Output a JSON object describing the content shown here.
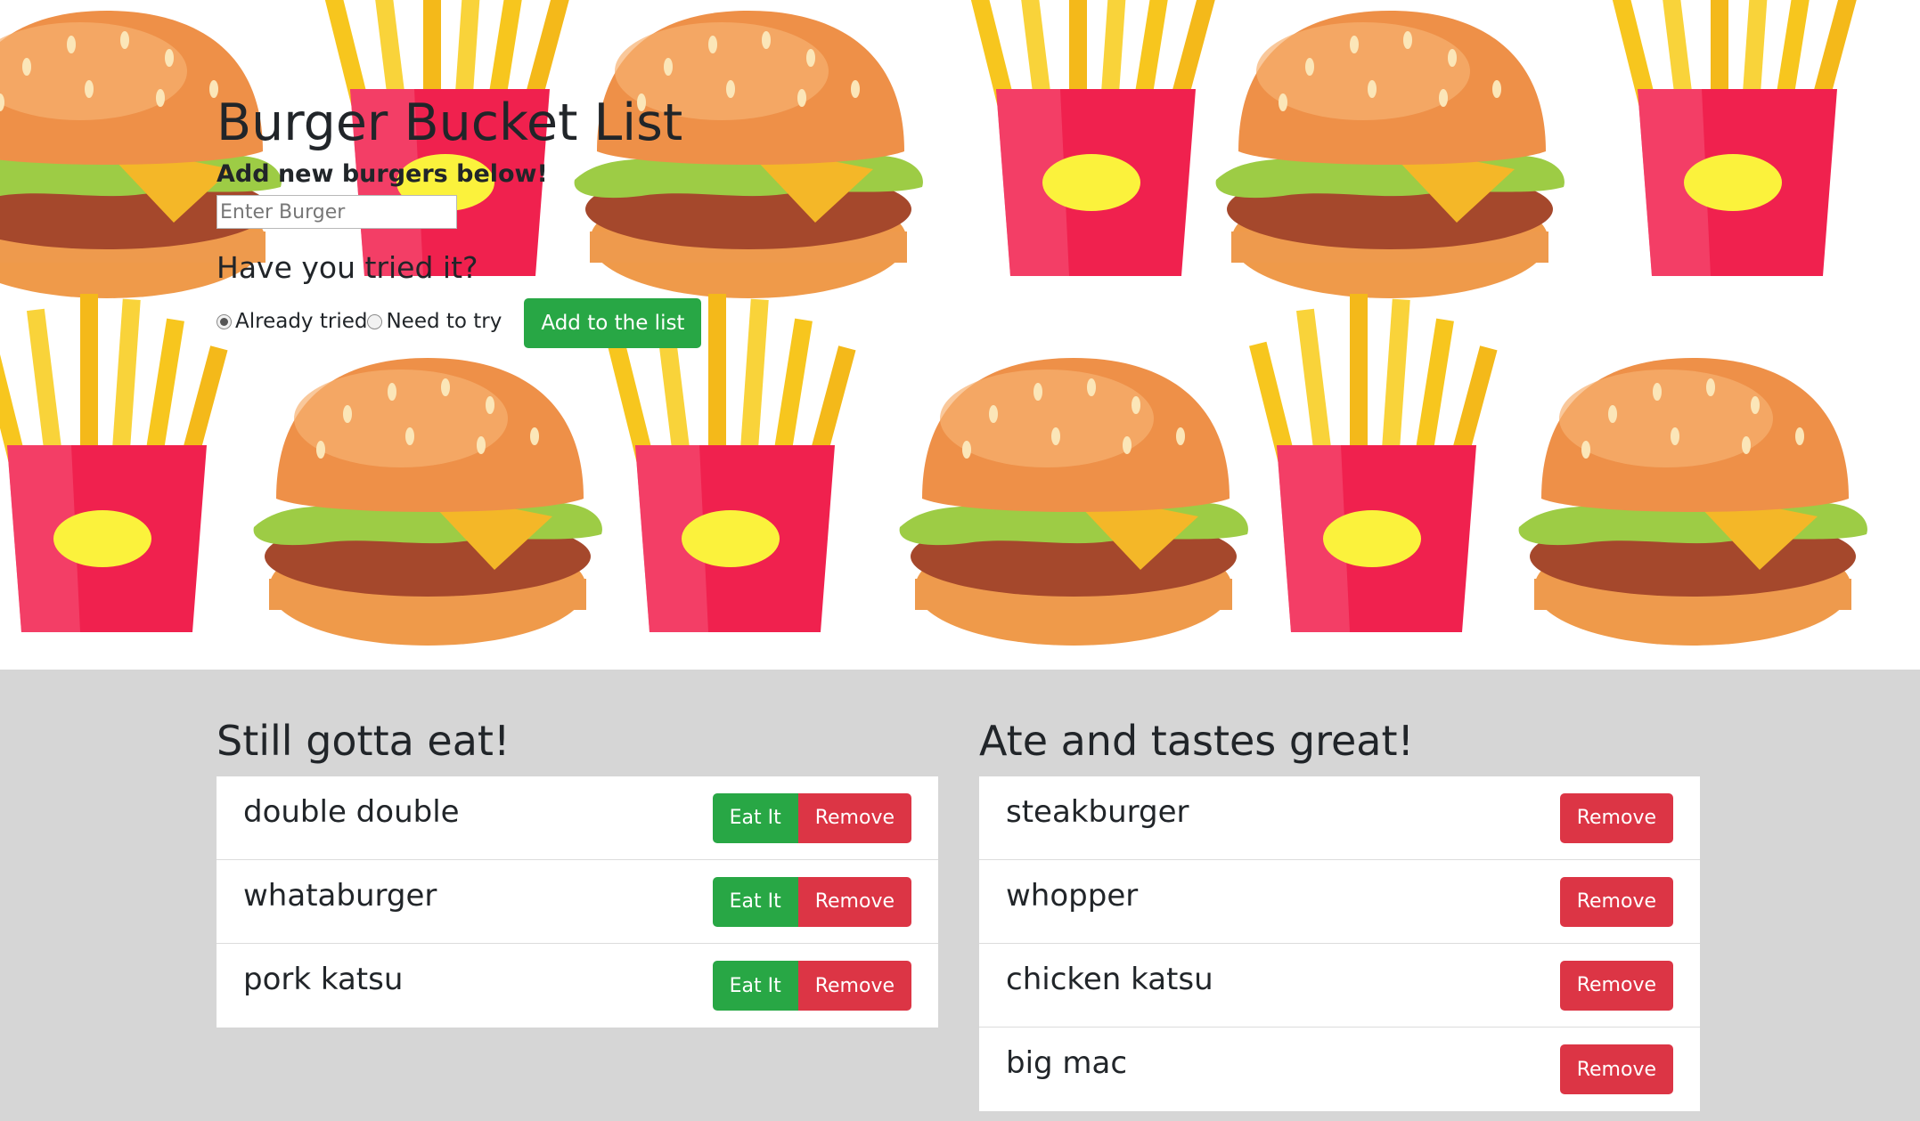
{
  "form": {
    "title": "Burger Bucket List",
    "subtitle": "Add new burgers below!",
    "input_placeholder": "Enter Burger",
    "question": "Have you tried it?",
    "radio_tried": "Already tried",
    "radio_need": "Need to try",
    "radio_selected": "Already tried",
    "add_button": "Add to the list"
  },
  "left_list": {
    "title": "Still gotta eat!",
    "items": [
      {
        "name": "double double",
        "eat": "Eat It",
        "remove": "Remove"
      },
      {
        "name": "whataburger",
        "eat": "Eat It",
        "remove": "Remove"
      },
      {
        "name": "pork katsu",
        "eat": "Eat It",
        "remove": "Remove"
      }
    ]
  },
  "right_list": {
    "title": "Ate and tastes great!",
    "items": [
      {
        "name": "steakburger",
        "remove": "Remove"
      },
      {
        "name": "whopper",
        "remove": "Remove"
      },
      {
        "name": "chicken katsu",
        "remove": "Remove"
      },
      {
        "name": "big mac",
        "remove": "Remove"
      }
    ]
  },
  "colors": {
    "success": "#28a745",
    "danger": "#dc3545",
    "lower_background": "#d6d6d6"
  },
  "background_pattern": [
    "burger-icon",
    "fries-icon"
  ]
}
